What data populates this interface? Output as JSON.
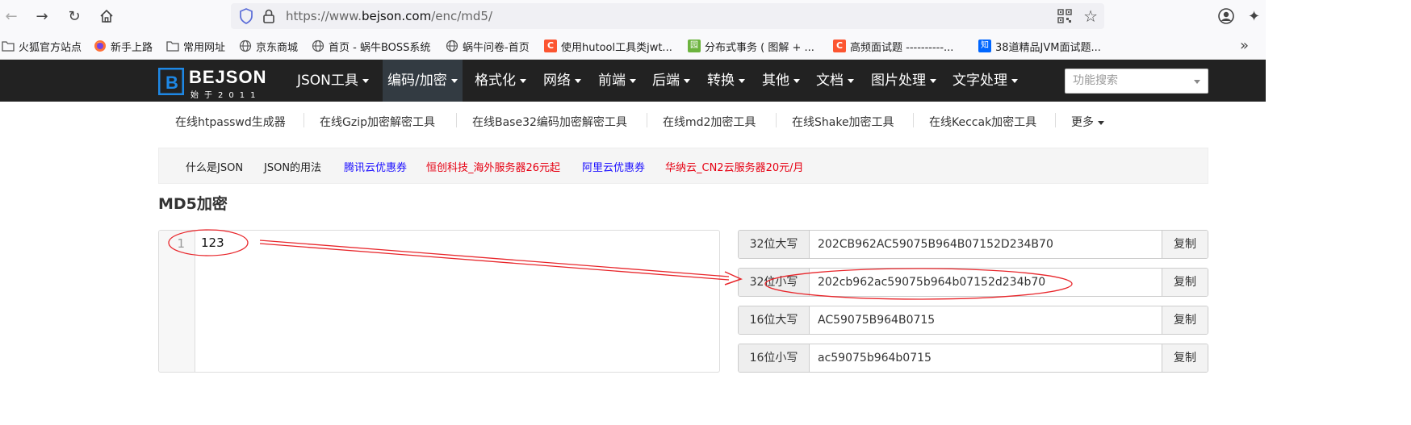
{
  "browser": {
    "url_prefix": "https://www.",
    "url_domain": "bejson.com",
    "url_path": "/enc/md5/"
  },
  "bookmarks": [
    {
      "label": "火狐官方站点",
      "icon": "folder-icon"
    },
    {
      "label": "新手上路",
      "icon": "firefox-icon"
    },
    {
      "label": "常用网址",
      "icon": "folder-icon"
    },
    {
      "label": "京东商城",
      "icon": "globe-icon"
    },
    {
      "label": "首页 - 蜗牛BOSS系统",
      "icon": "globe-icon"
    },
    {
      "label": "蜗牛问卷-首页",
      "icon": "globe-icon"
    },
    {
      "label": "使用hutool工具类jwt...",
      "icon": "csdn-icon"
    },
    {
      "label": "分布式事务 ( 图解 + ...",
      "icon": "blog-icon"
    },
    {
      "label": "高频面试题 ----------...",
      "icon": "csdn-icon"
    },
    {
      "label": "38道精品JVM面试题...",
      "icon": "zhihu-icon"
    }
  ],
  "site": {
    "logo_name": "BEJSON",
    "logo_sub": "始于2011",
    "menu": [
      "JSON工具",
      "编码/加密",
      "格式化",
      "网络",
      "前端",
      "后端",
      "转换",
      "其他",
      "文档",
      "图片处理",
      "文字处理"
    ],
    "search_placeholder": "功能搜索"
  },
  "subnav": [
    "在线htpasswd生成器",
    "在线Gzip加密解密工具",
    "在线Base32编码加密解密工具",
    "在线md2加密工具",
    "在线Shake加密工具",
    "在线Keccak加密工具",
    "更多"
  ],
  "promo": [
    {
      "label": "什么是JSON",
      "color": "#222222"
    },
    {
      "label": "JSON的用法",
      "color": "#222222"
    },
    {
      "label": "腾讯云优惠券",
      "color": "#1a0dff"
    },
    {
      "label": "恒创科技_海外服务器26元起",
      "color": "#e60012"
    },
    {
      "label": "阿里云优惠券",
      "color": "#1a0dff"
    },
    {
      "label": "华纳云_CN2云服务器20元/月",
      "color": "#e60012"
    }
  ],
  "page_title": "MD5加密",
  "editor": {
    "line_number": "1",
    "content": "123"
  },
  "results": [
    {
      "label": "32位大写",
      "value": "202CB962AC59075B964B07152D234B70",
      "copy": "复制"
    },
    {
      "label": "32位小写",
      "value": "202cb962ac59075b964b07152d234b70",
      "copy": "复制"
    },
    {
      "label": "16位大写",
      "value": "AC59075B964B0715",
      "copy": "复制"
    },
    {
      "label": "16位小写",
      "value": "ac59075b964b0715",
      "copy": "复制"
    }
  ],
  "colors": {
    "annotation": "#e8262b",
    "navbar": "#222222",
    "logo_blue": "#1e88e5"
  }
}
